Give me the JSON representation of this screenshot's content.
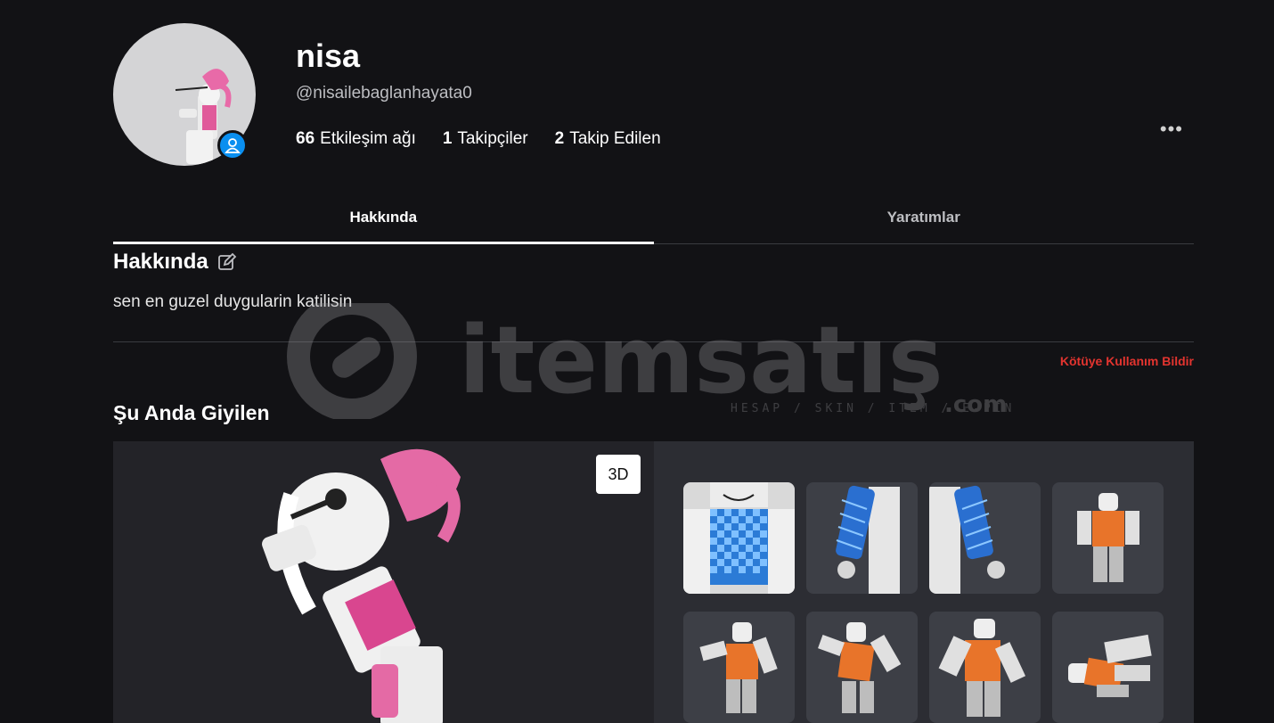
{
  "profile": {
    "display_name": "nisa",
    "username": "@nisailebaglanhayata0",
    "stats": [
      {
        "count": "66",
        "label": "Etkileşim ağı"
      },
      {
        "count": "1",
        "label": "Takipçiler"
      },
      {
        "count": "2",
        "label": "Takip Edilen"
      }
    ],
    "more_label": "•••"
  },
  "tabs": [
    {
      "label": "Hakkında",
      "active": true
    },
    {
      "label": "Yaratımlar",
      "active": false
    }
  ],
  "about": {
    "title": "Hakkında",
    "text": "sen en guzel duygularin katilisin",
    "report_label": "Kötüye Kullanım Bildir"
  },
  "wearing": {
    "title": "Şu Anda Giyilen",
    "toggle_label": "3D",
    "items": [
      {
        "icon": "shirt-checker-front"
      },
      {
        "icon": "shirt-sleeve-left"
      },
      {
        "icon": "shirt-sleeve-right"
      },
      {
        "icon": "avatar-orange-pose-1"
      },
      {
        "icon": "avatar-orange-pose-2"
      },
      {
        "icon": "avatar-orange-pose-3"
      },
      {
        "icon": "avatar-orange-pose-4"
      },
      {
        "icon": "avatar-orange-pose-5"
      }
    ]
  },
  "watermark": {
    "brand": "itemsatış",
    "tagline": "HESAP / SKIN / ITEM / E-PIN",
    "suffix": ".com"
  },
  "colors": {
    "background": "#121215",
    "accent_blue": "#0a8ff0",
    "report_red": "#e3342f",
    "panel": "#232328",
    "item_tile": "#3d3f46"
  }
}
